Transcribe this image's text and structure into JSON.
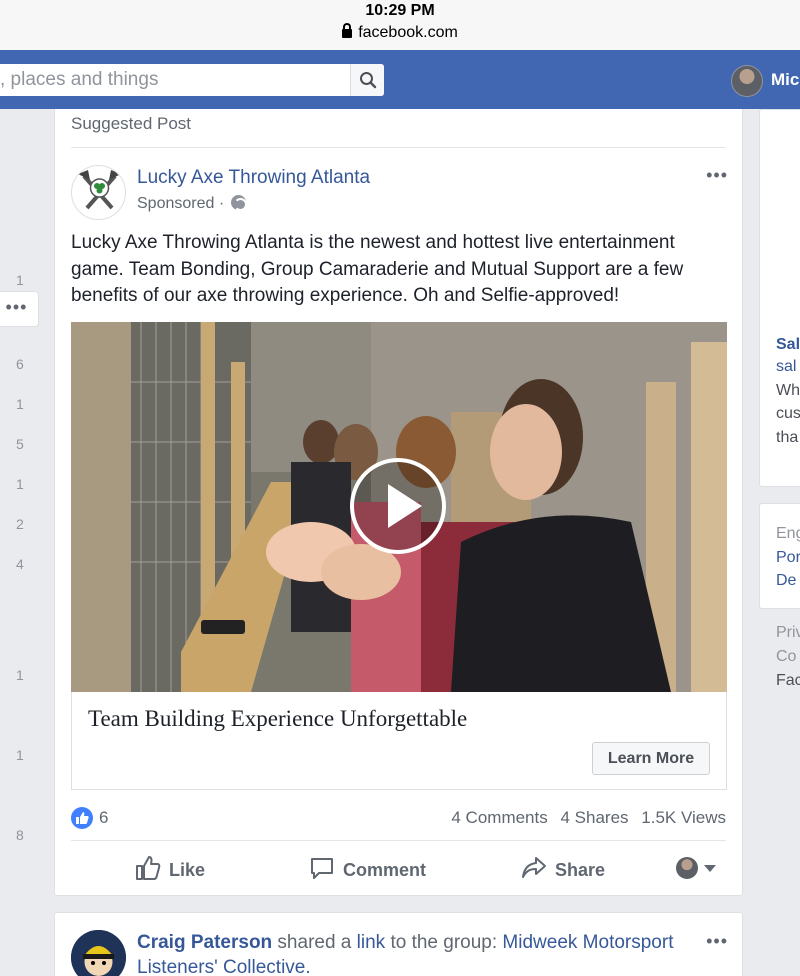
{
  "status_bar": {
    "time": "10:29 PM",
    "url": "facebook.com"
  },
  "header": {
    "search_placeholder": ", places and things",
    "user_name": "Mic"
  },
  "left_column": {
    "more_label": "•••",
    "numbers": [
      "1",
      "6",
      "1",
      "5",
      "1",
      "2",
      "4",
      "1",
      "1",
      "8"
    ]
  },
  "right_column": {
    "card1": [
      "Sal",
      "sal",
      "Wh",
      "cus",
      "tha"
    ],
    "card2": [
      "Eng",
      "Por",
      "De"
    ],
    "footer": [
      "Priv",
      "Co",
      "Fac"
    ]
  },
  "post": {
    "section_label": "Suggested Post",
    "page_name": "Lucky Axe Throwing Atlanta",
    "sponsored": "Sponsored ·",
    "more": "•••",
    "text": "Lucky Axe Throwing Atlanta is the newest and hottest live entertainment game. Team Bonding, Group Camaraderie and Mutual Support are a few benefits of our axe throwing experience. Oh and Selfie-approved!",
    "link_title": "Team Building Experience Unforgettable",
    "cta": "Learn More",
    "likes": "6",
    "comments": "4 Comments",
    "shares": "4 Shares",
    "views": "1.5K Views",
    "actions": {
      "like": "Like",
      "comment": "Comment",
      "share": "Share"
    }
  },
  "post2": {
    "author": "Craig Paterson",
    "shared_a": " shared a ",
    "link_word": "link",
    "to_group": " to the group: ",
    "group": "Midweek Motorsport Listeners' Collective.",
    "more": "•••"
  },
  "colors": {
    "facebook_blue": "#4267b2",
    "link_blue": "#365899",
    "like_blue": "#4080ff"
  },
  "icons": [
    "lock-icon",
    "search-icon",
    "globe-icon",
    "play-icon",
    "like-thumb-icon",
    "comment-icon",
    "share-icon",
    "chevron-down-icon"
  ]
}
